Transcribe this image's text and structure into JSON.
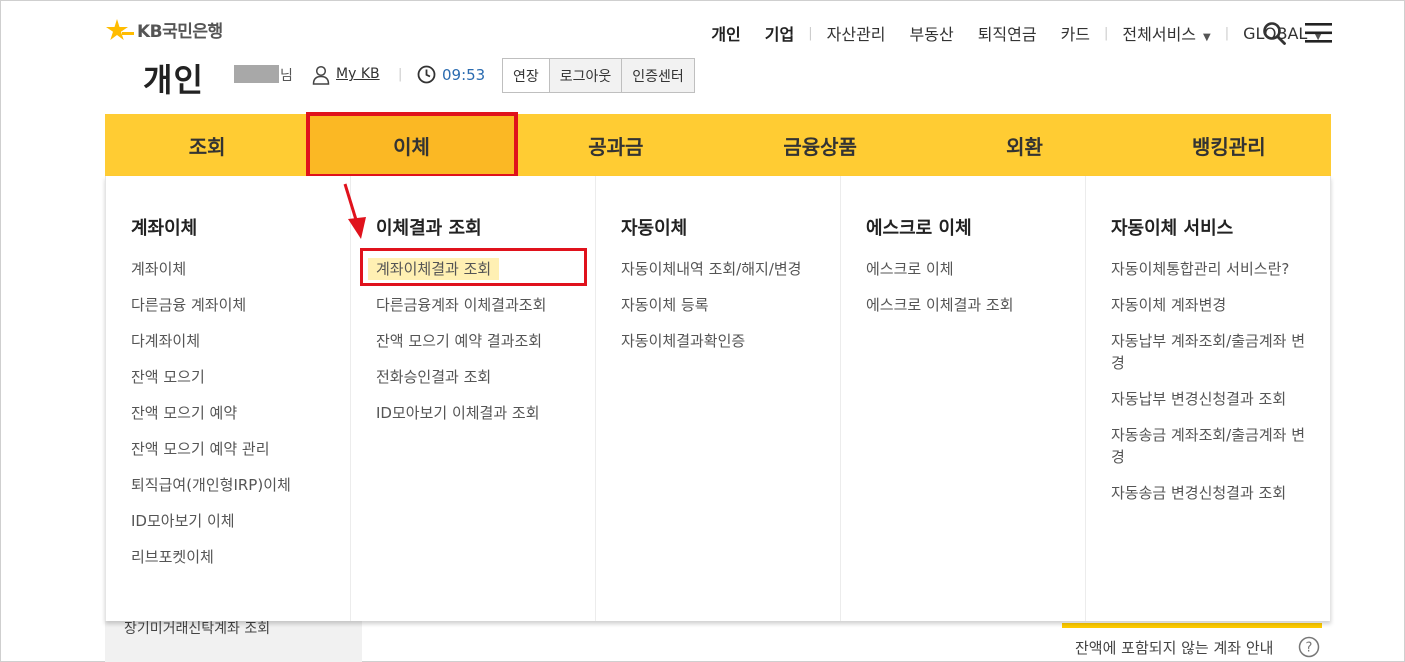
{
  "brand": {
    "name": "KB국민은행"
  },
  "top_nav": [
    {
      "label": "개인",
      "bold": true
    },
    {
      "label": "기업",
      "bold": true
    },
    {
      "label": "자산관리"
    },
    {
      "label": "부동산"
    },
    {
      "label": "퇴직연금"
    },
    {
      "label": "카드"
    },
    {
      "label": "전체서비스"
    },
    {
      "label": "GLOBAL"
    }
  ],
  "session": {
    "page_title": "개인",
    "name_suffix": "님",
    "mykb_label": "My KB",
    "timer": "09:53",
    "buttons": [
      "연장",
      "로그아웃",
      "인증센터"
    ]
  },
  "gnb": {
    "active_index": 1,
    "items": [
      "조회",
      "이체",
      "공과금",
      "금융상품",
      "외환",
      "뱅킹관리"
    ]
  },
  "mega_menu": [
    {
      "heading": "계좌이체",
      "items": [
        "계좌이체",
        "다른금융 계좌이체",
        "다계좌이체",
        "잔액 모으기",
        "잔액 모으기 예약",
        "잔액 모으기 예약 관리",
        "퇴직급여(개인형IRP)이체",
        "ID모아보기 이체",
        "리브포켓이체"
      ]
    },
    {
      "heading": "이체결과 조회",
      "items": [
        "계좌이체결과 조회",
        "다른금융계좌 이체결과조회",
        "잔액 모으기 예약 결과조회",
        "전화승인결과 조회",
        "ID모아보기 이체결과 조회"
      ]
    },
    {
      "heading": "자동이체",
      "items": [
        "자동이체내역 조회/해지/변경",
        "자동이체 등록",
        "자동이체결과확인증"
      ]
    },
    {
      "heading": "에스크로 이체",
      "items": [
        "에스크로 이체",
        "에스크로 이체결과 조회"
      ]
    },
    {
      "heading": "자동이체 서비스",
      "items": [
        "자동이체통합관리 서비스란?",
        "자동이체 계좌변경",
        "자동납부 계좌조회/출금계좌 변경",
        "자동납부 변경신청결과 조회",
        "자동송금 계좌조회/출금계좌 변경",
        "자동송금 변경신청결과 조회"
      ]
    }
  ],
  "highlighted_item": "계좌이체결과 조회",
  "under": {
    "left_text": "장기미거래신탁계좌 조회",
    "note": "잔액에 포함되지 않는 계좌 안내"
  },
  "colors": {
    "gnb_bg": "#ffcc33",
    "gnb_active": "#fbb824",
    "highlight_red": "#e0121c",
    "item_highlight": "#fff0b3"
  }
}
